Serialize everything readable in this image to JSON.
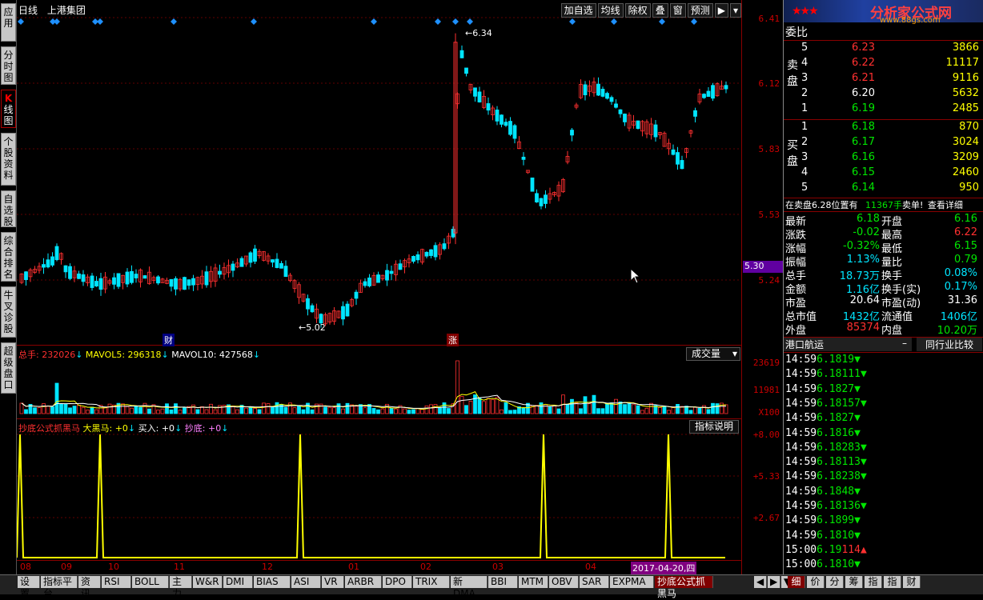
{
  "chart_header": {
    "period": "日线",
    "stock_name": "上港集团"
  },
  "toolbar": [
    "加自选",
    "均线",
    "除权",
    "叠",
    "窗",
    "预测",
    "▶",
    "▾"
  ],
  "left_tabs": [
    {
      "label": "应用",
      "active": false
    },
    {
      "label": "分时图",
      "active": false
    },
    {
      "label": "K线图",
      "active": true
    },
    {
      "label": "个股资料",
      "active": false
    },
    {
      "label": "自选股",
      "active": false
    },
    {
      "label": "综合排名",
      "active": false
    },
    {
      "label": "牛叉诊股",
      "active": false
    },
    {
      "label": "超级盘口",
      "active": false
    }
  ],
  "price_axis": [
    "6.41",
    "6.12",
    "5.83",
    "5.53",
    "5.24"
  ],
  "price_cursor_label": "5.30",
  "annotations": {
    "high": "6.34",
    "low": "5.02",
    "marker_cai": "财",
    "marker_zhang": "涨"
  },
  "volume_header": {
    "label": "总手: 232026",
    "mavol5": "MAVOL5: 296318",
    "mavol10": "MAVOL10: 427568",
    "dropdown": "成交量"
  },
  "volume_axis": [
    "23619",
    "11981",
    "X100"
  ],
  "indicator_header": {
    "name": "抄底公式抓黑马",
    "dhm": "大黑马: +0",
    "buy": "买入: +0",
    "cd": "抄底: +0",
    "help": "指标说明"
  },
  "indicator_axis": [
    "+8.00",
    "+5.33",
    "+2.67"
  ],
  "x_axis": [
    "08",
    "09",
    "10",
    "11",
    "12",
    "01",
    "02",
    "03",
    "04"
  ],
  "x_cursor_date": "2017-04-20,四",
  "bottom_tabs": [
    "设置",
    "指标平台",
    "资讯",
    "RSI",
    "BOLL",
    "主力",
    "W&R",
    "DMI",
    "BIAS",
    "ASI",
    "VR",
    "ARBR",
    "DPO",
    "TRIX",
    "新DMA",
    "BBI",
    "MTM",
    "OBV",
    "SAR",
    "EXPMA",
    "抄底公式抓黑马"
  ],
  "right_bottom_tabs": [
    "细",
    "价",
    "分",
    "筹",
    "指",
    "指",
    "财"
  ],
  "logo": {
    "title": "分析家公式网",
    "url": "www.88gs.com"
  },
  "order_book": {
    "header": "委比",
    "sell_label": "卖盘",
    "buy_label": "买盘",
    "sell": [
      {
        "level": "5",
        "price": "6.23",
        "vol": "3866"
      },
      {
        "level": "4",
        "price": "6.22",
        "vol": "11117"
      },
      {
        "level": "3",
        "price": "6.21",
        "vol": "9116"
      },
      {
        "level": "2",
        "price": "6.20",
        "vol": "5632"
      },
      {
        "level": "1",
        "price": "6.19",
        "vol": "2485"
      }
    ],
    "buy": [
      {
        "level": "1",
        "price": "6.18",
        "vol": "870"
      },
      {
        "level": "2",
        "price": "6.17",
        "vol": "3024"
      },
      {
        "level": "3",
        "price": "6.16",
        "vol": "3209"
      },
      {
        "level": "4",
        "price": "6.15",
        "vol": "2460"
      },
      {
        "level": "5",
        "price": "6.14",
        "vol": "950"
      }
    ],
    "notice": "在卖盘6.28位置有",
    "notice_vol": "11367手",
    "notice_tail": "卖单!",
    "notice_link": "查看详细"
  },
  "quote": [
    {
      "l1": "最新",
      "v1": "6.18",
      "l2": "开盘",
      "v2": "6.16"
    },
    {
      "l1": "涨跌",
      "v1": "-0.02",
      "l2": "最高",
      "v2": "6.22"
    },
    {
      "l1": "涨幅",
      "v1": "-0.32%",
      "l2": "最低",
      "v2": "6.15"
    },
    {
      "l1": "振幅",
      "v1": "1.13%",
      "l2": "量比",
      "v2": "0.79"
    },
    {
      "l1": "总手",
      "v1": "18.73万",
      "l2": "换手",
      "v2": "0.08%"
    },
    {
      "l1": "金额",
      "v1": "1.16亿",
      "l2": "换手(实)",
      "v2": "0.17%"
    },
    {
      "l1": "市盈",
      "v1": "20.64",
      "l2": "市盈(动)",
      "v2": "31.36"
    },
    {
      "l1": "总市值",
      "v1": "1432亿",
      "l2": "流通值",
      "v2": "1406亿"
    },
    {
      "l1": "外盘",
      "v1": "85374",
      "l2": "内盘",
      "v2": "10.20万"
    }
  ],
  "industry": {
    "name": "港口航运",
    "sign": "–",
    "compare": "同行业比较"
  },
  "ticks": [
    {
      "time": "14:59",
      "price": "6.18",
      "vol": "19",
      "dir": "down"
    },
    {
      "time": "14:59",
      "price": "6.18",
      "vol": "111",
      "dir": "down"
    },
    {
      "time": "14:59",
      "price": "6.18",
      "vol": "27",
      "dir": "down"
    },
    {
      "time": "14:59",
      "price": "6.18",
      "vol": "157",
      "dir": "down"
    },
    {
      "time": "14:59",
      "price": "6.18",
      "vol": "27",
      "dir": "down"
    },
    {
      "time": "14:59",
      "price": "6.18",
      "vol": "16",
      "dir": "down"
    },
    {
      "time": "14:59",
      "price": "6.18",
      "vol": "283",
      "dir": "down"
    },
    {
      "time": "14:59",
      "price": "6.18",
      "vol": "113",
      "dir": "down"
    },
    {
      "time": "14:59",
      "price": "6.18",
      "vol": "238",
      "dir": "down"
    },
    {
      "time": "14:59",
      "price": "6.18",
      "vol": "48",
      "dir": "down"
    },
    {
      "time": "14:59",
      "price": "6.18",
      "vol": "136",
      "dir": "down"
    },
    {
      "time": "14:59",
      "price": "6.18",
      "vol": "99",
      "dir": "down"
    },
    {
      "time": "14:59",
      "price": "6.18",
      "vol": "10",
      "dir": "down"
    },
    {
      "time": "15:00",
      "price": "6.19",
      "vol": "114",
      "dir": "up"
    },
    {
      "time": "15:00",
      "price": "6.18",
      "vol": "10",
      "dir": "down"
    }
  ],
  "colors": {
    "up": "#ff3030",
    "down": "#00e5ff",
    "axis": "#800000",
    "indicator": "#ffff00"
  }
}
